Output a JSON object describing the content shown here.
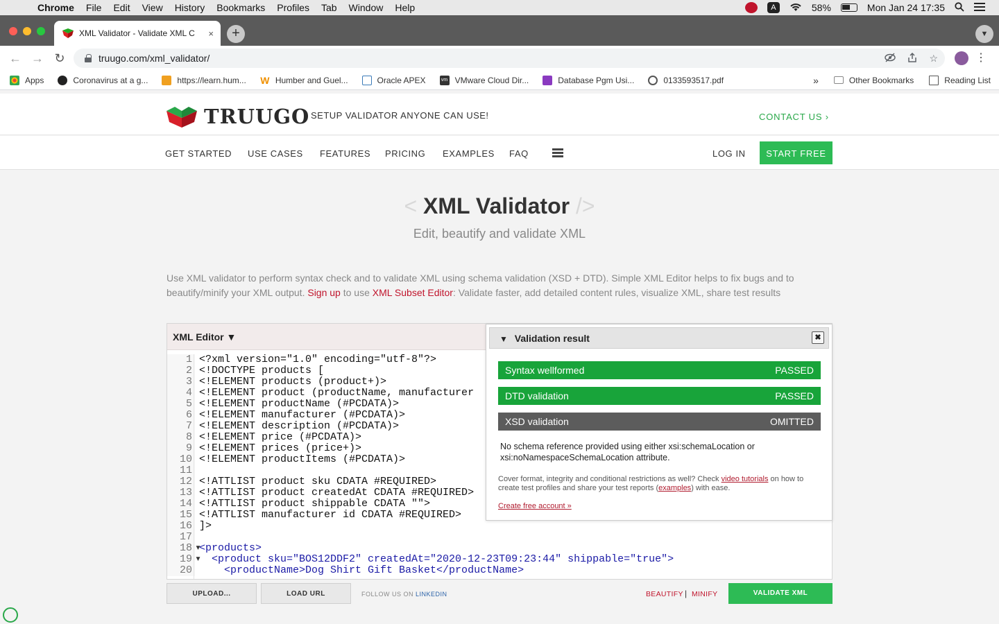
{
  "menubar": {
    "items": [
      "Chrome",
      "File",
      "Edit",
      "View",
      "History",
      "Bookmarks",
      "Profiles",
      "Tab",
      "Window",
      "Help"
    ],
    "status_a": "A",
    "battery": "58%",
    "datetime": "Mon Jan 24  17:35"
  },
  "browser": {
    "tab_title": "XML Validator - Validate XML C",
    "tab_close": "×",
    "newtab": "+",
    "url": "truugo.com/xml_validator/",
    "bookmarks": [
      {
        "label": "Apps",
        "color": "#e8453c"
      },
      {
        "label": "Coronavirus at a g...",
        "color": "#222222"
      },
      {
        "label": "https://learn.hum...",
        "color": "#f0a020"
      },
      {
        "label": "Humber and Guel...",
        "color": "#f09000"
      },
      {
        "label": "Oracle APEX",
        "color": "#3a7ab8"
      },
      {
        "label": "VMware Cloud Dir...",
        "color": "#333333"
      },
      {
        "label": "Database Pgm Usi...",
        "color": "#8a3ac0"
      },
      {
        "label": "0133593517.pdf",
        "color": "#555555"
      }
    ],
    "more": "»",
    "other_bookmarks": "Other Bookmarks",
    "reading_list": "Reading List"
  },
  "site": {
    "logo": "TRUUGO",
    "tagline": "SETUP VALIDATOR ANYONE CAN USE!",
    "contact": "CONTACT US ›",
    "nav": [
      "GET STARTED",
      "USE CASES",
      "FEATURES",
      "PRICING",
      "EXAMPLES",
      "FAQ"
    ],
    "login": "LOG IN",
    "start_free": "START FREE"
  },
  "hero": {
    "bracket_left": "<",
    "title": "XML Validator",
    "bracket_right": "/>",
    "subtitle": "Edit, beautify and validate XML"
  },
  "intro": {
    "part1": "Use XML validator to perform syntax check and to validate XML using schema validation (XSD + DTD). Simple XML Editor helps to fix bugs and to beautify/minify your XML output. ",
    "signup": "Sign up",
    "part2": " to use ",
    "subset": "XML Subset Editor",
    "part3": ": Validate faster, add detailed content rules, visualize XML, share test results"
  },
  "editor": {
    "header": "XML Editor ▼",
    "lines": [
      {
        "n": "1",
        "fold": "",
        "text": "<?xml version=\"1.0\" encoding=\"utf-8\"?>"
      },
      {
        "n": "2",
        "fold": "",
        "text": "<!DOCTYPE products ["
      },
      {
        "n": "3",
        "fold": "",
        "text": "<!ELEMENT products (product+)>"
      },
      {
        "n": "4",
        "fold": "",
        "text": "<!ELEMENT product (productName, manufacturer"
      },
      {
        "n": "5",
        "fold": "",
        "text": "<!ELEMENT productName (#PCDATA)>"
      },
      {
        "n": "6",
        "fold": "",
        "text": "<!ELEMENT manufacturer (#PCDATA)>"
      },
      {
        "n": "7",
        "fold": "",
        "text": "<!ELEMENT description (#PCDATA)>"
      },
      {
        "n": "8",
        "fold": "",
        "text": "<!ELEMENT price (#PCDATA)>"
      },
      {
        "n": "9",
        "fold": "",
        "text": "<!ELEMENT prices (price+)>"
      },
      {
        "n": "10",
        "fold": "",
        "text": "<!ELEMENT productItems (#PCDATA)>"
      },
      {
        "n": "11",
        "fold": "",
        "text": ""
      },
      {
        "n": "12",
        "fold": "",
        "text": "<!ATTLIST product sku CDATA #REQUIRED>"
      },
      {
        "n": "13",
        "fold": "",
        "text": "<!ATTLIST product createdAt CDATA #REQUIRED>"
      },
      {
        "n": "14",
        "fold": "",
        "text": "<!ATTLIST product shippable CDATA \"\">"
      },
      {
        "n": "15",
        "fold": "",
        "text": "<!ATTLIST manufacturer id CDATA #REQUIRED>"
      },
      {
        "n": "16",
        "fold": "",
        "text": "]>"
      },
      {
        "n": "17",
        "fold": "",
        "text": ""
      },
      {
        "n": "18",
        "fold": "▾",
        "text": "<products>"
      },
      {
        "n": "19",
        "fold": "▾",
        "text": "  <product sku=\"BOS12DDF2\" createdAt=\"2020-12-23T09:23:44\" shippable=\"true\">"
      },
      {
        "n": "20",
        "fold": "",
        "text": "    <productName>Dog Shirt Gift Basket</productName>"
      }
    ]
  },
  "validation": {
    "title": "Validation result",
    "close": "✖",
    "rows": [
      {
        "label": "Syntax wellformed",
        "status": "PASSED"
      },
      {
        "label": "DTD validation",
        "status": "PASSED"
      },
      {
        "label": "XSD validation",
        "status": "OMITTED"
      }
    ],
    "note": "No schema reference provided using either xsi:schemaLocation or xsi:noNamespaceSchemaLocation attribute.",
    "cover_part1": "Cover format, integrity and conditional restrictions as well? Check ",
    "video_tutorials": "video tutorials",
    "cover_part2": " on how to create test profiles and share your test reports (",
    "examples": "examples",
    "cover_part3": ") with ease.",
    "create_account": "Create free account »"
  },
  "bottom": {
    "upload": "UPLOAD...",
    "load_url": "LOAD URL",
    "follow": "FOLLOW US ON ",
    "linkedin": "LINKEDIN",
    "beautify": "BEAUTIFY",
    "separator": "|",
    "minify": "MINIFY",
    "validate": "VALIDATE XML"
  },
  "colors": {
    "accent_green": "#2dbb55",
    "pass_green": "#18a43a",
    "omit_grey": "#5c5c5c",
    "link_red": "#c0142c"
  }
}
